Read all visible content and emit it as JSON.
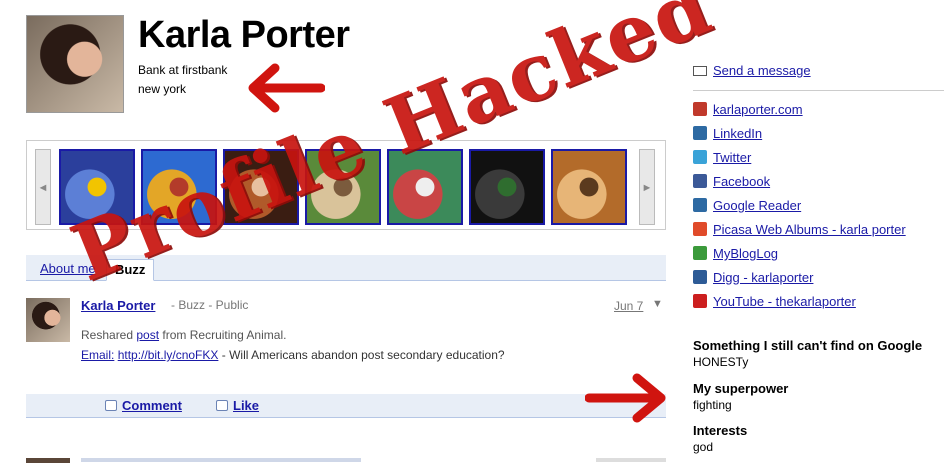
{
  "profile": {
    "name": "Karla Porter",
    "job": "Bank at firstbank",
    "location": "new york"
  },
  "photo_strip": {
    "prev_label": "◄",
    "next_label": "►",
    "thumbnails": [
      {
        "subject": "blue flower",
        "colors": [
          "#2b3f9c",
          "#5c7fd6",
          "#f2c400"
        ]
      },
      {
        "subject": "colorful buildings",
        "colors": [
          "#2d6ad1",
          "#e3a627",
          "#b33b2a"
        ]
      },
      {
        "subject": "friends at restaurant",
        "colors": [
          "#3a1d12",
          "#b05a2a",
          "#e7c0a0"
        ]
      },
      {
        "subject": "group photo",
        "colors": [
          "#5a8a3a",
          "#d9c39a",
          "#7b5b3d"
        ]
      },
      {
        "subject": "beaded curtain",
        "colors": [
          "#3c8a5a",
          "#c94545",
          "#eeeeee"
        ]
      },
      {
        "subject": "black cat",
        "colors": [
          "#111111",
          "#3a3a3a",
          "#2f6d2f"
        ]
      },
      {
        "subject": "orange cat",
        "colors": [
          "#b36b2a",
          "#e7b577",
          "#5b3a1e"
        ]
      }
    ]
  },
  "tabs": [
    {
      "label": "About me",
      "active": false
    },
    {
      "label": "Buzz",
      "active": true
    }
  ],
  "post": {
    "author": "Karla Porter",
    "source": "- Buzz - Public",
    "date": "Jun 7",
    "menu": "▼",
    "line1_pre": "Reshared ",
    "line1_link": "post",
    "line1_post": " from Recruiting Animal.",
    "line2_label": "Email:",
    "line2_link": "http://bit.ly/cnoFKX",
    "line2_text": " - Will Americans abandon post secondary education?",
    "actions": {
      "comment": "Comment",
      "like": "Like"
    }
  },
  "sidebar": {
    "send_message": "Send a message",
    "links": [
      {
        "label": "karlaporter.com",
        "icon": "site-icon",
        "color": "#c0392b"
      },
      {
        "label": "LinkedIn",
        "icon": "linkedin-icon",
        "color": "#2d6aa3"
      },
      {
        "label": "Twitter",
        "icon": "twitter-icon",
        "color": "#3aa3d8"
      },
      {
        "label": "Facebook",
        "icon": "facebook-icon",
        "color": "#3b5998"
      },
      {
        "label": "Google Reader",
        "icon": "google-reader-icon",
        "color": "#2d6aa3"
      },
      {
        "label": "Picasa Web Albums - karla porter",
        "icon": "picasa-icon",
        "color": "#e04b2a"
      },
      {
        "label": "MyBlogLog",
        "icon": "mybloglog-icon",
        "color": "#3b9a3b"
      },
      {
        "label": "Digg - karlaporter",
        "icon": "digg-icon",
        "color": "#2d5b96"
      },
      {
        "label": "YouTube - thekarlaporter",
        "icon": "youtube-icon",
        "color": "#cc1f1f"
      }
    ],
    "facts": [
      {
        "heading": "Something I still can't find on Google",
        "value": "HONESTy"
      },
      {
        "heading": "My superpower",
        "value": "fighting"
      },
      {
        "heading": "Interests",
        "value": "god"
      }
    ]
  },
  "overlay": {
    "stamp": "Profile Hacked",
    "stamp_color": "#c8140f"
  },
  "colors": {
    "link": "#1a1aa6",
    "tab_bar": "#e8eef7",
    "accent_red": "#d0140f"
  }
}
